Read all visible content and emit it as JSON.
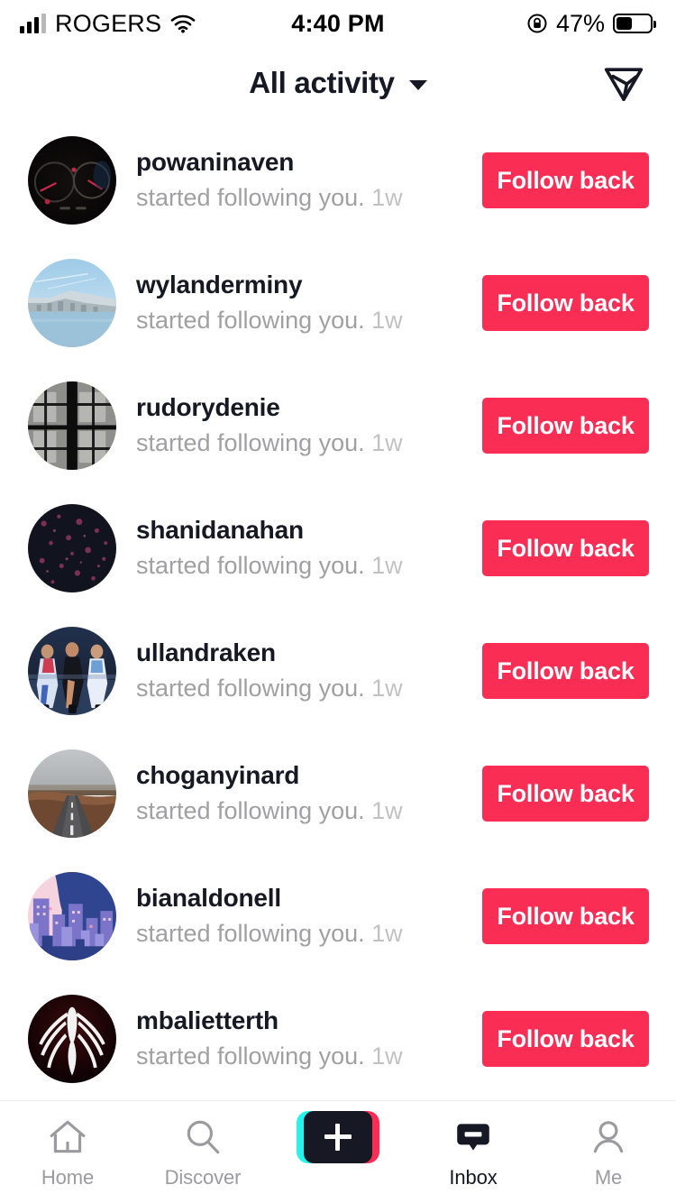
{
  "status_bar": {
    "carrier": "ROGERS",
    "time": "4:40 PM",
    "battery_percent": "47%",
    "signal_icon": "signal-bars-icon",
    "wifi_icon": "wifi-icon",
    "rotation_lock_icon": "rotation-lock-icon",
    "battery_icon": "battery-icon",
    "battery_fill_ratio": 0.47
  },
  "header": {
    "title": "All activity",
    "caret_icon": "chevron-down-icon",
    "send_icon": "send-message-icon"
  },
  "notifications": [
    {
      "username": "powaninaven",
      "action": "started following you.",
      "time": "1w",
      "button": "Follow back",
      "avatar": "car-dashboard"
    },
    {
      "username": "wylanderminy",
      "action": "started following you.",
      "time": "1w",
      "button": "Follow back",
      "avatar": "coastal-town"
    },
    {
      "username": "rudorydenie",
      "action": "started following you.",
      "time": "1w",
      "button": "Follow back",
      "avatar": "window-grid"
    },
    {
      "username": "shanidanahan",
      "action": "started following you.",
      "time": "1w",
      "button": "Follow back",
      "avatar": "dark-speckles"
    },
    {
      "username": "ullandraken",
      "action": "started following you.",
      "time": "1w",
      "button": "Follow back",
      "avatar": "runway-models"
    },
    {
      "username": "choganyinard",
      "action": "started following you.",
      "time": "1w",
      "button": "Follow back",
      "avatar": "desert-road"
    },
    {
      "username": "bianaldonell",
      "action": "started following you.",
      "time": "1w",
      "button": "Follow back",
      "avatar": "city-illustration"
    },
    {
      "username": "mbalietterth",
      "action": "started following you.",
      "time": "1w",
      "button": "Follow back",
      "avatar": "spider-logo"
    }
  ],
  "tabbar": {
    "items": [
      {
        "label": "Home",
        "icon": "home-icon",
        "active": false
      },
      {
        "label": "Discover",
        "icon": "search-icon",
        "active": false
      },
      {
        "label": "",
        "icon": "create-plus-icon",
        "active": false
      },
      {
        "label": "Inbox",
        "icon": "inbox-icon",
        "active": true
      },
      {
        "label": "Me",
        "icon": "person-icon",
        "active": false
      }
    ]
  },
  "colors": {
    "accent_pink": "#fa2d55",
    "tiktok_cyan": "#25f4ee",
    "tiktok_red": "#fe2c55",
    "dark": "#161823",
    "muted_text": "#a0a0a3"
  }
}
